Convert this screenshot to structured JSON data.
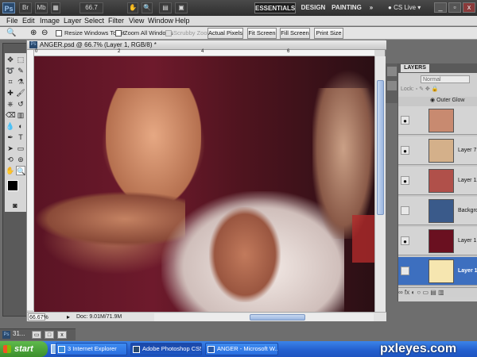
{
  "app_bar": {
    "logo": "Ps",
    "btn_br": "Br",
    "btn_mb": "Mb",
    "zoom": "66.7",
    "workspaces": [
      "ESSENTIALS",
      "DESIGN",
      "PAINTING"
    ],
    "more": "»",
    "cs_live": "CS Live",
    "window_controls": [
      "_",
      "▫",
      "x"
    ]
  },
  "menu": [
    "File",
    "Edit",
    "Image",
    "Layer",
    "Select",
    "Filter",
    "View",
    "Window",
    "Help"
  ],
  "options": {
    "resize_windows": "Resize Windows To Fit",
    "zoom_all": "Zoom All Windows",
    "scrubby": "Scrubby Zoom",
    "buttons": [
      "Actual Pixels",
      "Fit Screen",
      "Fill Screen",
      "Print Size"
    ]
  },
  "document": {
    "title": "ANGER.psd @ 66.7% (Layer 1, RGB/8) *",
    "zoom": "66.67%",
    "doc_info": "Doc: 9.01M/71.9M",
    "ruler_marks": [
      "0",
      "2",
      "4",
      "6"
    ]
  },
  "layers_panel": {
    "title": "LAYERS",
    "blend_mode": "Normal",
    "lock_label": "Lock:",
    "effect": "Outer Glow",
    "layers": [
      {
        "name": "",
        "visible": true,
        "selected": false,
        "thumb": "#c88a70"
      },
      {
        "name": "Layer 7",
        "visible": true,
        "selected": false,
        "thumb": "#d4b08a"
      },
      {
        "name": "Layer 12",
        "visible": true,
        "selected": false,
        "thumb": "#b0504a"
      },
      {
        "name": "Backgro",
        "visible": false,
        "selected": false,
        "thumb": "#3a5a8a"
      },
      {
        "name": "Layer 1 c",
        "visible": true,
        "selected": false,
        "thumb": "#6a1020"
      },
      {
        "name": "Layer 1",
        "visible": false,
        "selected": true,
        "thumb": "#f6e6b0"
      }
    ],
    "footer": "∞  fx  ◐  ○  ▭  ▤  ▥"
  },
  "taskbar": {
    "start": "start",
    "tasks": [
      "3 Internet Explorer",
      "Adobe Photoshop CS5",
      "ANGER - Microsoft W..."
    ],
    "mini_doc": "31..."
  },
  "watermark": "pxleyes.com",
  "colors": {
    "ui_bg": "#6e6e6e",
    "selection_blue": "#3d6fbf",
    "taskbar_blue": "#2460cf",
    "start_green": "#3b8f2c"
  }
}
